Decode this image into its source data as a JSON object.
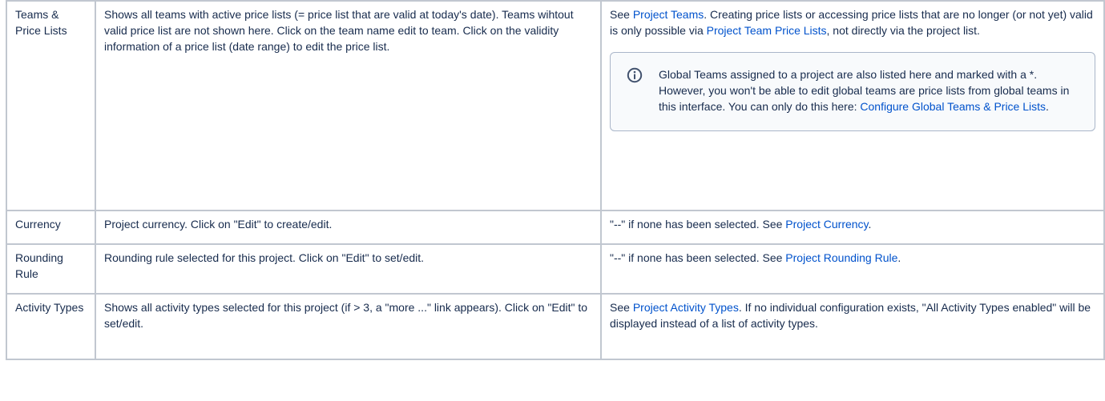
{
  "rows": [
    {
      "col1": "Teams & Price Lists",
      "col2": "Shows all teams with active price lists (= price list that are valid at today's date). Teams wihtout valid price list are not shown here. Click on the team name edit to team. Click on the validity information of a price list (date range) to edit the price list.",
      "col3": {
        "pre": "See ",
        "link1": "Project Teams",
        "mid": ". Creating price lists or accessing price lists that are no longer (or not yet) valid is only possible via ",
        "link2": "Project Team Price Lists",
        "post": ", not directly via the project list."
      },
      "info_panel": {
        "icon": "info-icon",
        "text": "Global Teams assigned to a project are also listed here and marked with a *. However, you won't be able to edit global teams are price lists from global teams in this interface. You can only do this here: ",
        "link": "Configure Global Teams & Price Lists",
        "post": "."
      }
    },
    {
      "col1": "Currency",
      "col2": "Project currency. Click on \"Edit\" to create/edit.",
      "col3": {
        "pre": "\"--\" if none has been selected. See ",
        "link1": "Project Currency",
        "post": "."
      }
    },
    {
      "col1": "Rounding Rule",
      "col2": "Rounding rule selected for this project. Click on \"Edit\" to set/edit.",
      "col3": {
        "pre": "\"--\" if none has been selected. See ",
        "link1": "Project Rounding Rule",
        "post": "."
      }
    },
    {
      "col1": "Activity Types",
      "col2": "Shows all activity types selected for this project (if > 3, a \"more ...\" link appears). Click on \"Edit\" to set/edit.",
      "col3": {
        "pre": "See ",
        "link1": "Project Activity Types",
        "post": ". If no individual configuration exists, \"All Activity Types enabled\" will be displayed instead of a list of activity types."
      }
    }
  ],
  "colors": {
    "text": "#172b4d",
    "link": "#0052cc",
    "border": "#c1c7d0",
    "info_icon": "#42526e"
  }
}
